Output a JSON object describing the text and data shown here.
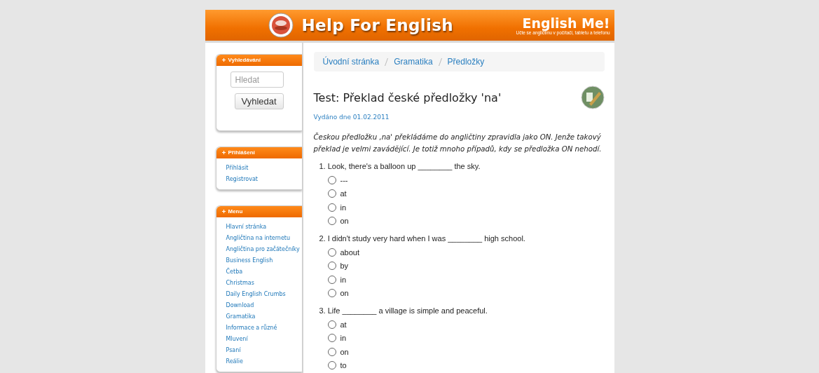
{
  "header": {
    "title": "Help For English",
    "brand": "English Me!",
    "tagline": "Učte se angličtinu v počítači, tabletu a telefonu"
  },
  "sidebar": [
    {
      "kind": "search",
      "title": "Vyhledávání",
      "placeholder": "Hledat",
      "button": "Vyhledat"
    },
    {
      "kind": "links",
      "title": "Přihlášení",
      "items": [
        "Přihlásit",
        "Registrovat"
      ]
    },
    {
      "kind": "links",
      "title": "Menu",
      "items": [
        "Hlavní stránka",
        "Angličtina na internetu",
        "Angličtina pro začátečníky",
        "Business English",
        "Četba",
        "Christmas",
        "Daily English Crumbs",
        "Download",
        "Gramatika",
        "Informace a různé",
        "Mluvení",
        "Psaní",
        "Reálie"
      ]
    }
  ],
  "breadcrumb": [
    "Úvodní stránka",
    "Gramatika",
    "Předložky"
  ],
  "article": {
    "title": "Test: Překlad české předložky 'na'",
    "date": "Vydáno dne 01.02.2011",
    "intro": "Českou předložku ,na' překládáme do angličtiny zpravidla jako ON. Jenže takový překlad je velmi zavádějící. Je totiž mnoho případů, kdy se předložka ON nehodí."
  },
  "questions": [
    {
      "text": "1. Look, there's a balloon up ________ the sky.",
      "options": [
        {
          "label": "---",
          "selected": false
        },
        {
          "label": "at",
          "selected": false
        },
        {
          "label": "in",
          "selected": false
        },
        {
          "label": "on",
          "selected": false
        }
      ]
    },
    {
      "text": "2. I didn't study very hard when I was ________ high school.",
      "options": [
        {
          "label": "about",
          "selected": false
        },
        {
          "label": "by",
          "selected": false
        },
        {
          "label": "in",
          "selected": false
        },
        {
          "label": "on",
          "selected": false
        }
      ]
    },
    {
      "text": "3. Life ________ a village is simple and peaceful.",
      "options": [
        {
          "label": "at",
          "selected": false
        },
        {
          "label": "in",
          "selected": false
        },
        {
          "label": "on",
          "selected": false
        },
        {
          "label": "to",
          "selected": false
        }
      ]
    }
  ]
}
